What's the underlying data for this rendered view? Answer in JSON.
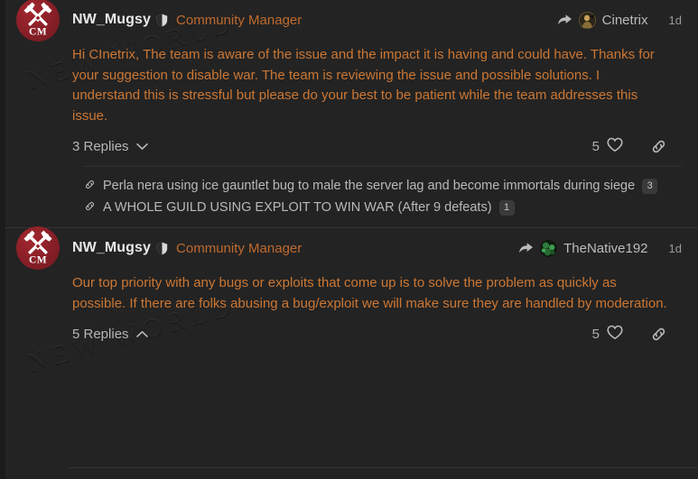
{
  "colors": {
    "background": "#232323",
    "post_background": "#232323",
    "accent_text": "#cc7733",
    "title_accent": "#c06a2e",
    "username": "#e9e9e9",
    "muted": "#b9b9b9",
    "divider": "#333333",
    "avatar_red": "#8e2028",
    "badge_bg": "#3a3a3a"
  },
  "watermark": {
    "text": "NEW WORLD"
  },
  "posts": [
    {
      "author": "NW_Mugsy",
      "author_badge_icon": "shield-icon",
      "author_title": "Community Manager",
      "reply_icon": "reply-arrow-icon",
      "reply_to": "Cinetrix",
      "reply_to_avatar": "cinetrix-avatar",
      "timestamp": "1d",
      "body": "Hi CInetrix, The team is aware of the issue and the impact it is having and could have. Thanks for your suggestion to disable war. The team is reviewing the issue and possible solutions. I understand this is stressful but please do your best to be patient while the team addresses this issue.",
      "replies_label": "3 Replies",
      "replies_chevron": "chevron-down-icon",
      "like_count": "5",
      "like_icon": "heart-icon",
      "link_icon": "link-icon",
      "linked_threads": [
        {
          "icon": "link-icon",
          "title": "Perla nera using ice gauntlet bug to male the server lag and become immortals during siege",
          "count": "3"
        },
        {
          "icon": "link-icon",
          "title": "A WHOLE GUILD USING EXPLOIT TO WIN WAR (After 9 defeats)",
          "count": "1"
        }
      ]
    },
    {
      "author": "NW_Mugsy",
      "author_badge_icon": "shield-icon",
      "author_title": "Community Manager",
      "reply_icon": "reply-arrow-icon",
      "reply_to": "TheNative192",
      "reply_to_avatar": "thenative192-avatar",
      "timestamp": "1d",
      "body": "Our top priority with any bugs or exploits that come up is to solve the problem as quickly as possible. If there are folks abusing a bug/exploit we will make sure they are handled by moderation.",
      "replies_label": "5 Replies",
      "replies_chevron": "chevron-up-icon",
      "like_count": "5",
      "like_icon": "heart-icon",
      "link_icon": "link-icon",
      "linked_threads": []
    }
  ]
}
